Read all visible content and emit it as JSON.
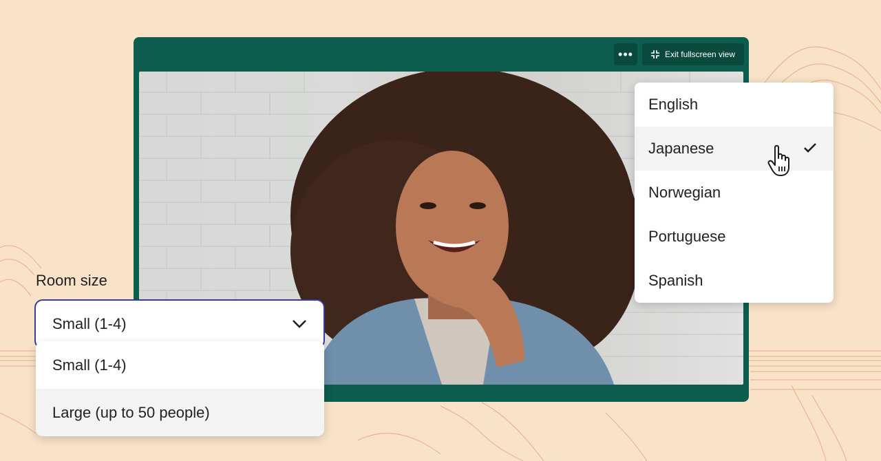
{
  "colors": {
    "background": "#f8e2c8",
    "window": "#0c5d4d",
    "select_border": "#3c3a9a",
    "line_art": "#e58a68"
  },
  "window": {
    "more_icon": "ellipsis-icon",
    "exit_fullscreen_label": "Exit fullscreen view"
  },
  "toolbar": {
    "items": [
      "camera-icon",
      "microphone-icon",
      "screen-share-icon",
      "record-icon",
      "chat-icon",
      "participants-icon",
      "raise-hand-icon"
    ]
  },
  "language_menu": {
    "items": [
      {
        "label": "English"
      },
      {
        "label": "Japanese",
        "selected": true
      },
      {
        "label": "Norwegian"
      },
      {
        "label": "Portuguese"
      },
      {
        "label": "Spanish"
      }
    ]
  },
  "room_size": {
    "label": "Room size",
    "value": "Small (1-4)",
    "options": [
      "Small (1-4)",
      "Large (up to 50 people)"
    ]
  }
}
